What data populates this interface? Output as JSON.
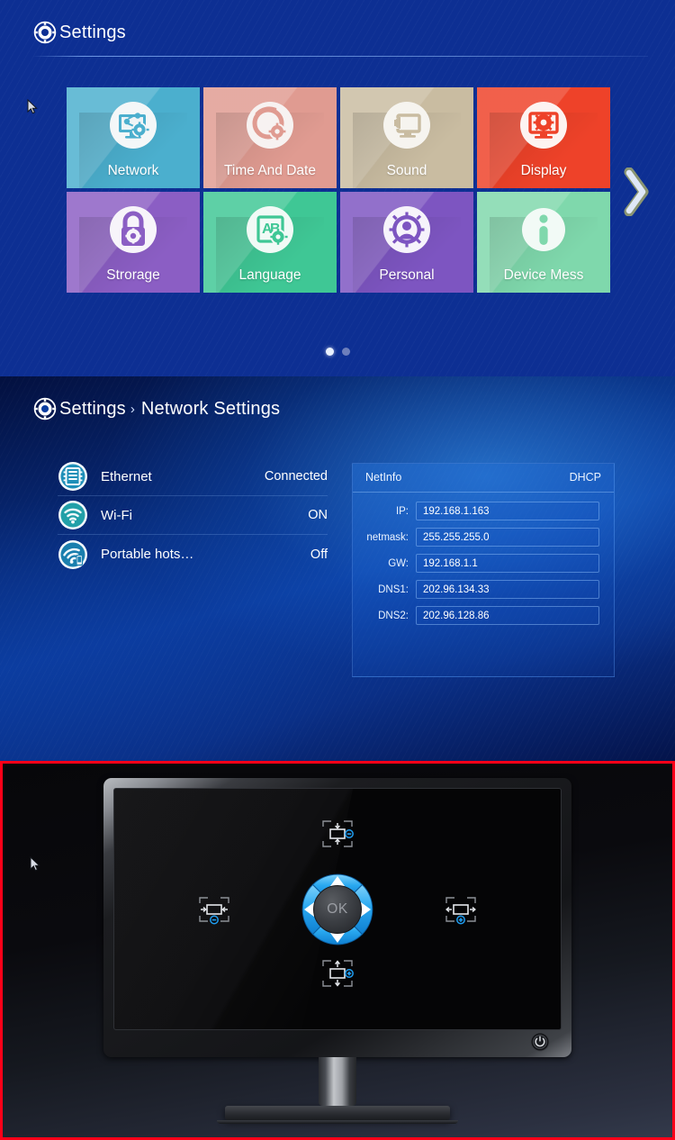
{
  "panel1": {
    "header": {
      "icon": "gear-icon",
      "title": "Settings"
    },
    "tiles": [
      {
        "label": "Network",
        "icon": "network-share-monitor-icon",
        "color": "#4BAFCE"
      },
      {
        "label": "Time And Date",
        "icon": "clock-gear-icon",
        "color": "#E09B91"
      },
      {
        "label": "Sound",
        "icon": "speaker-monitor-icon",
        "color": "#C9BCA1"
      },
      {
        "label": "Display",
        "icon": "display-gear-icon",
        "color": "#EE4229"
      },
      {
        "label": "Strorage",
        "icon": "lock-gear-icon",
        "color": "#8B5EC4"
      },
      {
        "label": "Language",
        "icon": "ab-translate-icon",
        "color": "#3FC795"
      },
      {
        "label": "Personal",
        "icon": "user-gear-icon",
        "color": "#7D55C1"
      },
      {
        "label": "Device Mess",
        "icon": "info-icon",
        "color": "#7FD8AC"
      }
    ],
    "next_arrow": "chevron-right-icon",
    "pager": {
      "total": 2,
      "active": 1
    }
  },
  "panel2": {
    "header": {
      "icon": "gear-icon",
      "title": "Settings",
      "separator": "›",
      "subtitle": "Network Settings"
    },
    "rows": [
      {
        "label": "Ethernet",
        "value": "Connected",
        "icon": "ethernet-port-icon"
      },
      {
        "label": "Wi-Fi",
        "value": "ON",
        "icon": "wifi-icon"
      },
      {
        "label": "Portable hots…",
        "value": "Off",
        "icon": "portable-hotspot-icon"
      }
    ],
    "netinfo": {
      "title": "NetInfo",
      "mode": "DHCP",
      "fields": [
        {
          "key": "IP:",
          "value": "192.168.1.163"
        },
        {
          "key": "netmask:",
          "value": "255.255.255.0"
        },
        {
          "key": "GW:",
          "value": "192.168.1.1"
        },
        {
          "key": "DNS1:",
          "value": "202.96.134.33"
        },
        {
          "key": "DNS2:",
          "value": "202.96.128.86"
        }
      ]
    }
  },
  "panel3": {
    "border_color": "#ff0018",
    "ok_label": "OK",
    "controls": {
      "up": "dpad-up-icon",
      "down": "dpad-down-icon",
      "left": "dpad-left-icon",
      "right": "dpad-right-icon",
      "shrink_vertical": "screen-height-decrease-icon",
      "grow_vertical": "screen-height-increase-icon",
      "shrink_horizontal": "screen-width-decrease-icon",
      "grow_horizontal": "screen-width-increase-icon"
    },
    "power_button": "power-icon"
  }
}
